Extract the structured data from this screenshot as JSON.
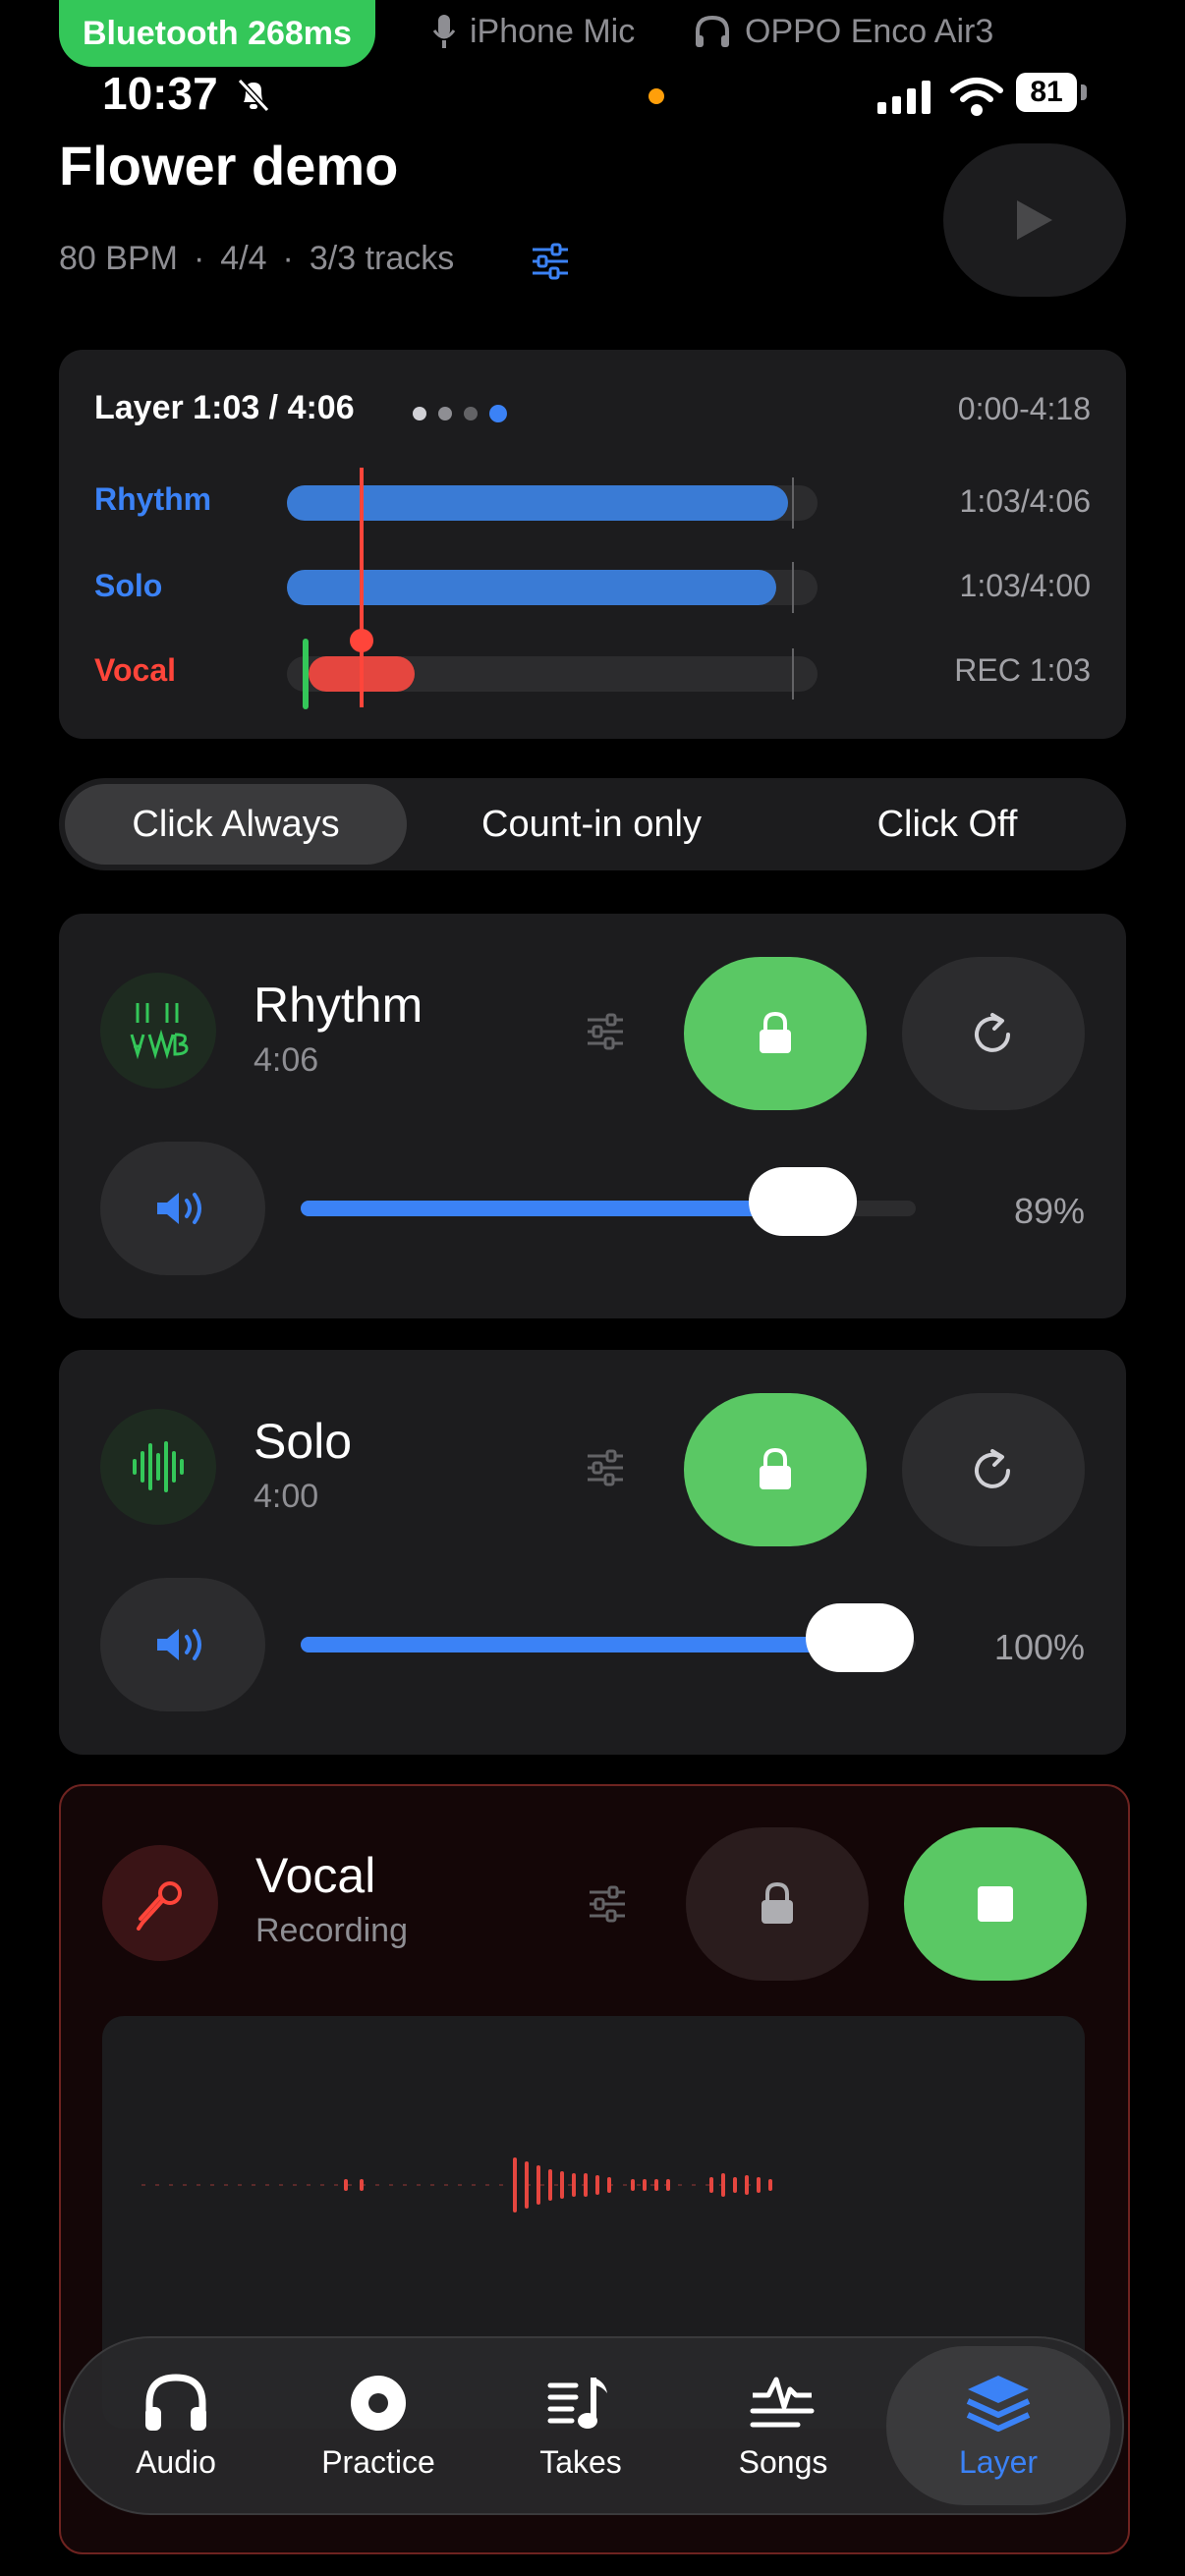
{
  "route": {
    "latency_badge": "Bluetooth 268ms",
    "mic": "iPhone Mic",
    "headphones": "OPPO Enco Air3"
  },
  "status": {
    "time": "10:37",
    "battery": "81"
  },
  "header": {
    "title": "Flower demo",
    "bpm": "80 BPM",
    "sep1": "·",
    "time_sig": "4/4",
    "sep2": "·",
    "tracks": "3/3 tracks"
  },
  "layer": {
    "title": "Layer 1:03 / 4:06",
    "range": "0:00-4:18",
    "page_dots": 4,
    "active_dot": 4,
    "tracks": [
      {
        "label": "Rhythm",
        "time": "1:03/4:06",
        "progress": 0.95,
        "color": "#3b82f6"
      },
      {
        "label": "Solo",
        "time": "1:03/4:00",
        "progress": 0.93,
        "color": "#3b82f6"
      },
      {
        "label": "Vocal",
        "time": "REC 1:03",
        "progress": 0.25,
        "color": "#ff453a"
      }
    ]
  },
  "click_mode": {
    "options": [
      "Click Always",
      "Count-in only",
      "Click Off"
    ],
    "selected": "Click Always"
  },
  "rhythm": {
    "name": "Rhythm",
    "duration": "4:06",
    "volume_pct": "89%",
    "volume": 0.89,
    "icon": "guitar-chords-icon"
  },
  "solo": {
    "name": "Solo",
    "duration": "4:00",
    "volume_pct": "100%",
    "volume": 1.0,
    "icon": "waveform-icon"
  },
  "vocal": {
    "name": "Vocal",
    "status": "Recording",
    "icon": "microphone-icon"
  },
  "tabs": [
    {
      "label": "Audio",
      "icon": "headphones-icon"
    },
    {
      "label": "Practice",
      "icon": "record-disc-icon"
    },
    {
      "label": "Takes",
      "icon": "music-list-icon"
    },
    {
      "label": "Songs",
      "icon": "waveform-lines-icon"
    },
    {
      "label": "Layer",
      "icon": "layers-icon"
    }
  ],
  "colors": {
    "accent": "#3b82f6",
    "record": "#ff453a",
    "lock_green": "#34c759"
  }
}
